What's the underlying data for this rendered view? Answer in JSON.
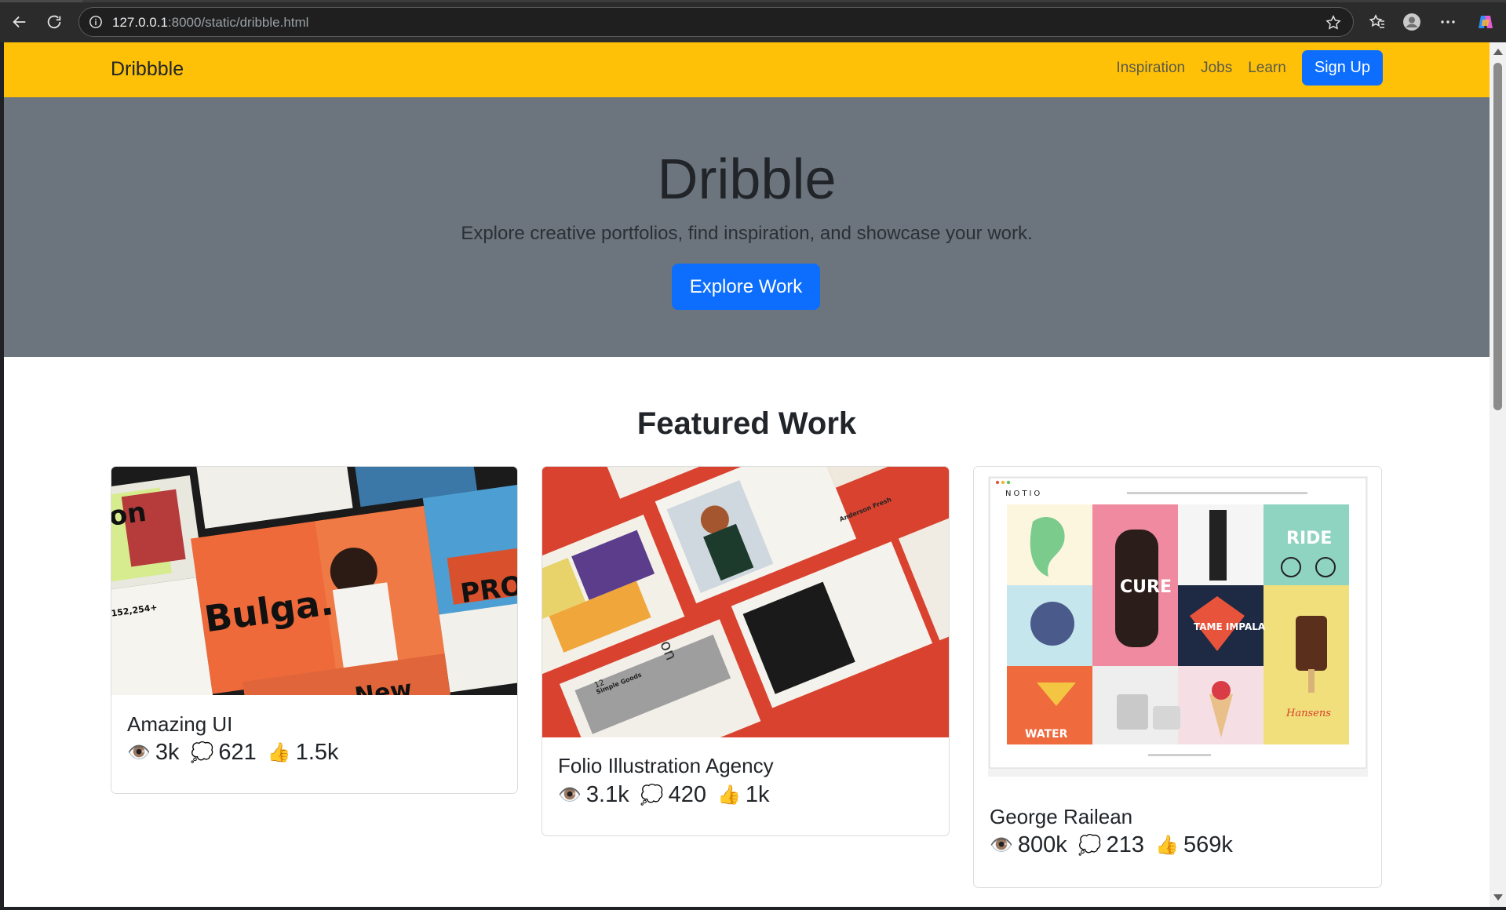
{
  "browser": {
    "url_host": "127.0.0.1",
    "url_path": ":8000/static/dribble.html"
  },
  "navbar": {
    "brand": "Dribbble",
    "links": [
      "Inspiration",
      "Jobs",
      "Learn"
    ],
    "signup_label": "Sign Up"
  },
  "hero": {
    "title": "Dribble",
    "subtitle": "Explore creative portfolios, find inspiration, and showcase your work.",
    "cta_label": "Explore Work"
  },
  "featured": {
    "title": "Featured Work",
    "cards": [
      {
        "title": "Amazing UI",
        "views": "3k",
        "comments": "621",
        "likes": "1.5k",
        "thumb_texts": [
          "Bulga.",
          "PRO",
          "New",
          "152,254+",
          "on"
        ]
      },
      {
        "title": "Folio Illustration Agency",
        "views": "3.1k",
        "comments": "420",
        "likes": "1k",
        "thumb_texts": [
          "Anderson Fresh",
          "Simple Goods",
          "12",
          "04",
          "on"
        ]
      },
      {
        "title": "George Railean",
        "views": "800k",
        "comments": "213",
        "likes": "569k",
        "thumb_texts": [
          "NOTIO",
          "RIDE",
          "TAME IMPALA",
          "CURE",
          "WATER",
          "Hansens"
        ]
      }
    ]
  },
  "icons": {
    "views": "👁️",
    "comments": "💭",
    "likes": "👍"
  },
  "colors": {
    "navbar": "#ffc107",
    "hero": "#6c757d",
    "primary": "#0d6efd"
  }
}
